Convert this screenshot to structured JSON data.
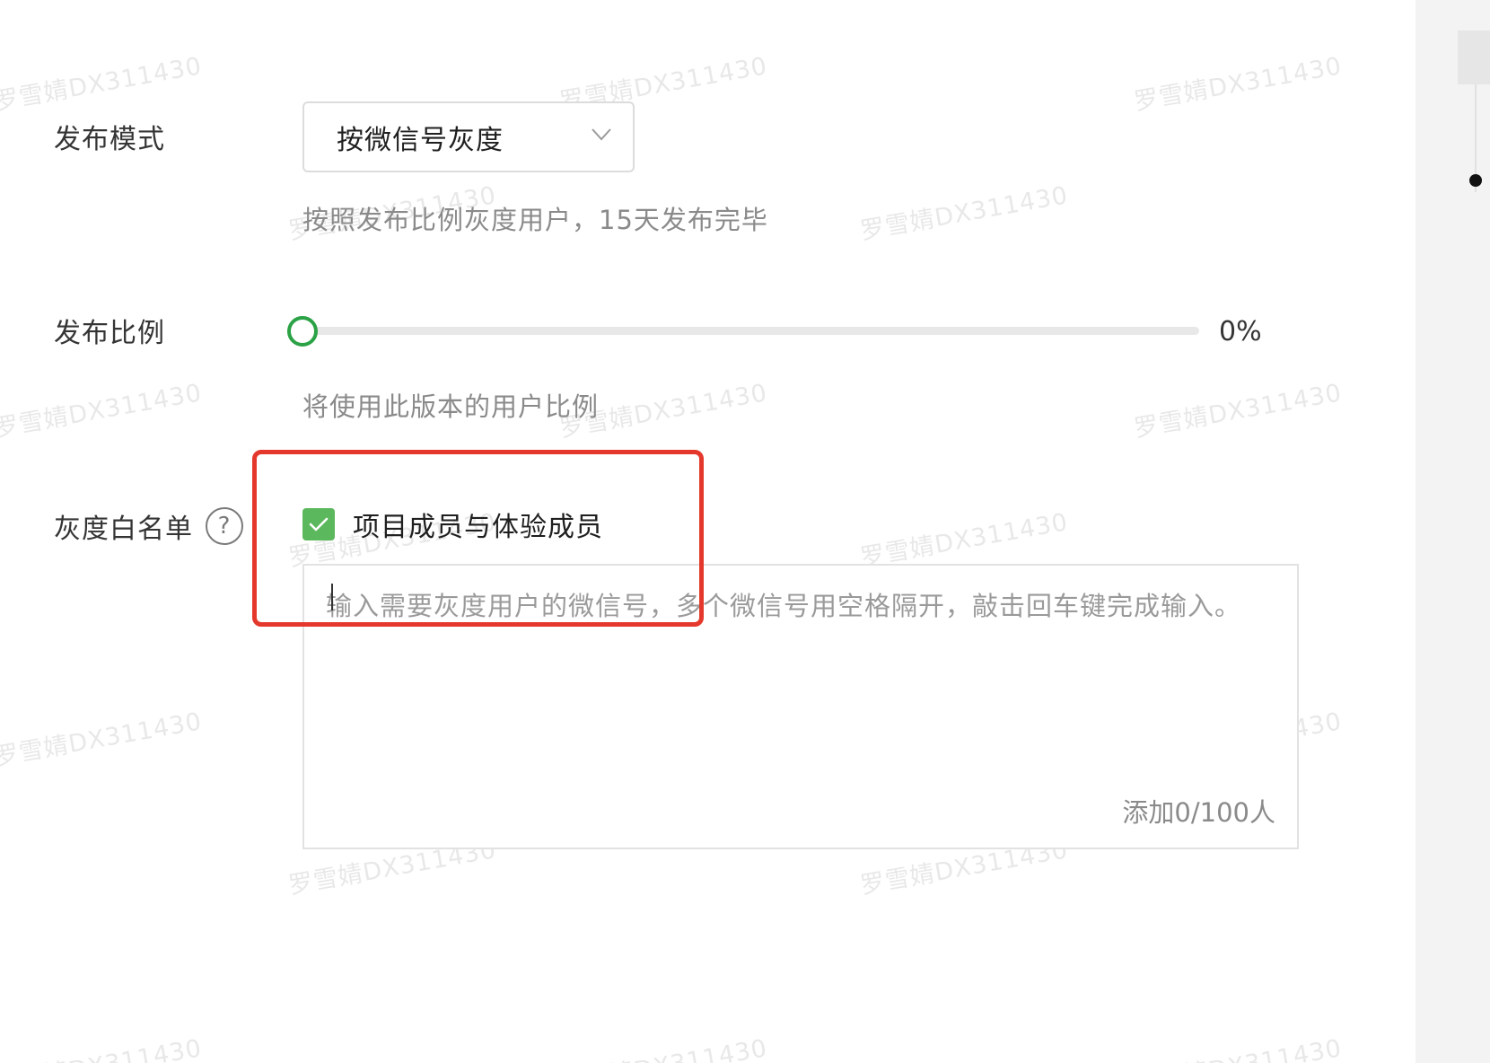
{
  "watermark_text": "罗雪婧DX311430",
  "publish_mode": {
    "label": "发布模式",
    "selected_value": "按微信号灰度",
    "hint": "按照发布比例灰度用户，15天发布完毕"
  },
  "publish_ratio": {
    "label": "发布比例",
    "value": 0,
    "value_text": "0%",
    "hint": "将使用此版本的用户比例"
  },
  "gray_whitelist": {
    "label": "灰度白名单",
    "help_symbol": "?",
    "checkbox": {
      "label": "项目成员与体验成员",
      "checked": true
    },
    "textarea": {
      "placeholder": "输入需要灰度用户的微信号，多个微信号用空格隔开，敲击回车键完成输入。",
      "value": "",
      "counter": "添加0/100人"
    }
  },
  "colors": {
    "accent_green": "#5cb85c",
    "slider_handle_border": "#2ba245",
    "annotation_red": "#e5382c"
  }
}
